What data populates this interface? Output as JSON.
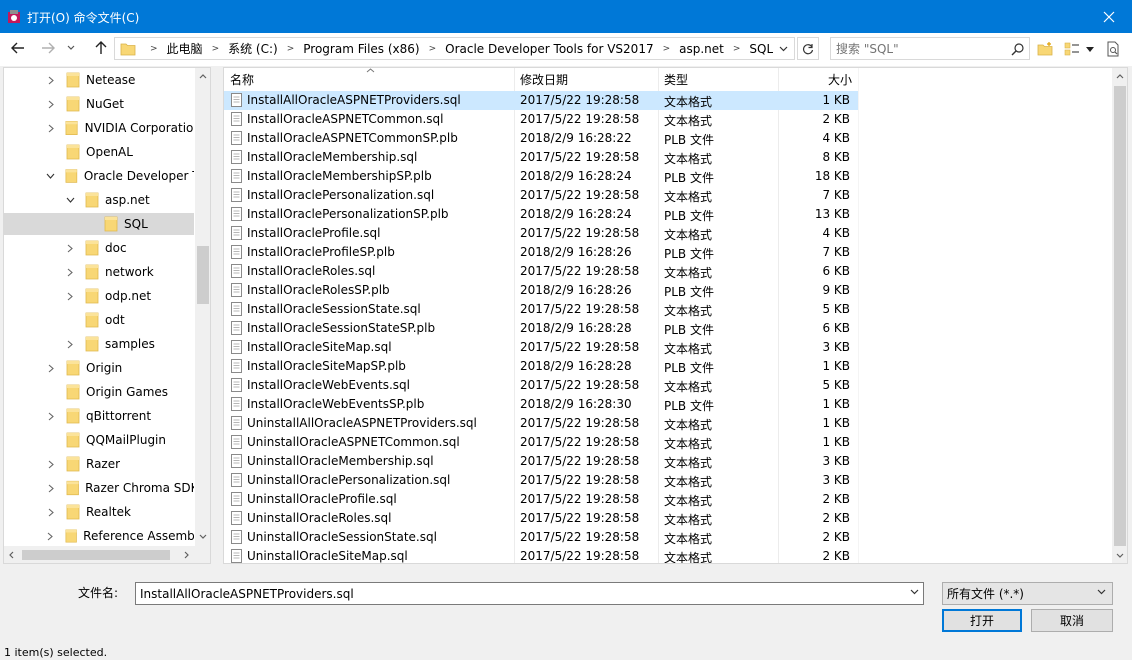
{
  "window": {
    "title": "打开(O) 命令文件(C)"
  },
  "address": {
    "crumbs": [
      "此电脑",
      "系统 (C:)",
      "Program Files (x86)",
      "Oracle Developer Tools for VS2017",
      "asp.net",
      "SQL"
    ]
  },
  "search": {
    "placeholder": "搜索 \"SQL\""
  },
  "tree": {
    "items": [
      {
        "label": "Netease",
        "chevron": "right",
        "indent": 0,
        "selected": false
      },
      {
        "label": "NuGet",
        "chevron": "right",
        "indent": 0,
        "selected": false
      },
      {
        "label": "NVIDIA Corporation",
        "chevron": "right",
        "indent": 0,
        "selected": false
      },
      {
        "label": "OpenAL",
        "chevron": "none",
        "indent": 0,
        "selected": false
      },
      {
        "label": "Oracle Developer To",
        "chevron": "down",
        "indent": 0,
        "selected": false
      },
      {
        "label": "asp.net",
        "chevron": "down",
        "indent": 1,
        "selected": false
      },
      {
        "label": "SQL",
        "chevron": "none",
        "indent": 2,
        "selected": true
      },
      {
        "label": "doc",
        "chevron": "right",
        "indent": 1,
        "selected": false
      },
      {
        "label": "network",
        "chevron": "right",
        "indent": 1,
        "selected": false
      },
      {
        "label": "odp.net",
        "chevron": "right",
        "indent": 1,
        "selected": false
      },
      {
        "label": "odt",
        "chevron": "none",
        "indent": 1,
        "selected": false
      },
      {
        "label": "samples",
        "chevron": "right",
        "indent": 1,
        "selected": false
      },
      {
        "label": "Origin",
        "chevron": "right",
        "indent": 0,
        "selected": false
      },
      {
        "label": "Origin Games",
        "chevron": "none",
        "indent": 0,
        "selected": false
      },
      {
        "label": "qBittorrent",
        "chevron": "right",
        "indent": 0,
        "selected": false
      },
      {
        "label": "QQMailPlugin",
        "chevron": "none",
        "indent": 0,
        "selected": false
      },
      {
        "label": "Razer",
        "chevron": "right",
        "indent": 0,
        "selected": false
      },
      {
        "label": "Razer Chroma SDK",
        "chevron": "right",
        "indent": 0,
        "selected": false
      },
      {
        "label": "Realtek",
        "chevron": "right",
        "indent": 0,
        "selected": false
      },
      {
        "label": "Reference Assemblie",
        "chevron": "right",
        "indent": 0,
        "selected": false
      }
    ]
  },
  "list": {
    "columns": {
      "name": "名称",
      "date": "修改日期",
      "type": "类型",
      "size": "大小"
    },
    "rows": [
      {
        "name": "InstallAllOracleASPNETProviders.sql",
        "date": "2017/5/22 19:28:58",
        "type": "文本格式",
        "size": "1 KB",
        "selected": true
      },
      {
        "name": "InstallOracleASPNETCommon.sql",
        "date": "2017/5/22 19:28:58",
        "type": "文本格式",
        "size": "2 KB"
      },
      {
        "name": "InstallOracleASPNETCommonSP.plb",
        "date": "2018/2/9 16:28:22",
        "type": "PLB 文件",
        "size": "4 KB"
      },
      {
        "name": "InstallOracleMembership.sql",
        "date": "2017/5/22 19:28:58",
        "type": "文本格式",
        "size": "8 KB"
      },
      {
        "name": "InstallOracleMembershipSP.plb",
        "date": "2018/2/9 16:28:24",
        "type": "PLB 文件",
        "size": "18 KB"
      },
      {
        "name": "InstallOraclePersonalization.sql",
        "date": "2017/5/22 19:28:58",
        "type": "文本格式",
        "size": "7 KB"
      },
      {
        "name": "InstallOraclePersonalizationSP.plb",
        "date": "2018/2/9 16:28:24",
        "type": "PLB 文件",
        "size": "13 KB"
      },
      {
        "name": "InstallOracleProfile.sql",
        "date": "2017/5/22 19:28:58",
        "type": "文本格式",
        "size": "4 KB"
      },
      {
        "name": "InstallOracleProfileSP.plb",
        "date": "2018/2/9 16:28:26",
        "type": "PLB 文件",
        "size": "7 KB"
      },
      {
        "name": "InstallOracleRoles.sql",
        "date": "2017/5/22 19:28:58",
        "type": "文本格式",
        "size": "6 KB"
      },
      {
        "name": "InstallOracleRolesSP.plb",
        "date": "2018/2/9 16:28:26",
        "type": "PLB 文件",
        "size": "9 KB"
      },
      {
        "name": "InstallOracleSessionState.sql",
        "date": "2017/5/22 19:28:58",
        "type": "文本格式",
        "size": "5 KB"
      },
      {
        "name": "InstallOracleSessionStateSP.plb",
        "date": "2018/2/9 16:28:28",
        "type": "PLB 文件",
        "size": "6 KB"
      },
      {
        "name": "InstallOracleSiteMap.sql",
        "date": "2017/5/22 19:28:58",
        "type": "文本格式",
        "size": "3 KB"
      },
      {
        "name": "InstallOracleSiteMapSP.plb",
        "date": "2018/2/9 16:28:28",
        "type": "PLB 文件",
        "size": "1 KB"
      },
      {
        "name": "InstallOracleWebEvents.sql",
        "date": "2017/5/22 19:28:58",
        "type": "文本格式",
        "size": "5 KB"
      },
      {
        "name": "InstallOracleWebEventsSP.plb",
        "date": "2018/2/9 16:28:30",
        "type": "PLB 文件",
        "size": "1 KB"
      },
      {
        "name": "UninstallAllOracleASPNETProviders.sql",
        "date": "2017/5/22 19:28:58",
        "type": "文本格式",
        "size": "1 KB"
      },
      {
        "name": "UninstallOracleASPNETCommon.sql",
        "date": "2017/5/22 19:28:58",
        "type": "文本格式",
        "size": "1 KB"
      },
      {
        "name": "UninstallOracleMembership.sql",
        "date": "2017/5/22 19:28:58",
        "type": "文本格式",
        "size": "3 KB"
      },
      {
        "name": "UninstallOraclePersonalization.sql",
        "date": "2017/5/22 19:28:58",
        "type": "文本格式",
        "size": "3 KB"
      },
      {
        "name": "UninstallOracleProfile.sql",
        "date": "2017/5/22 19:28:58",
        "type": "文本格式",
        "size": "2 KB"
      },
      {
        "name": "UninstallOracleRoles.sql",
        "date": "2017/5/22 19:28:58",
        "type": "文本格式",
        "size": "2 KB"
      },
      {
        "name": "UninstallOracleSessionState.sql",
        "date": "2017/5/22 19:28:58",
        "type": "文本格式",
        "size": "2 KB"
      },
      {
        "name": "UninstallOracleSiteMap.sql",
        "date": "2017/5/22 19:28:58",
        "type": "文本格式",
        "size": "2 KB"
      }
    ]
  },
  "bottom": {
    "filename_label": "文件名:",
    "filename_value": "InstallAllOracleASPNETProviders.sql",
    "filetype_value": "所有文件 (*.*)",
    "open_label": "打开",
    "cancel_label": "取消"
  },
  "status": {
    "text": "1 item(s) selected."
  },
  "colors": {
    "titlebar": "#0078d7",
    "selection": "#cce8ff",
    "folder": "#f8d775",
    "tree_selection": "#d9d9d9"
  },
  "icons": {
    "app": "toad-app-icon",
    "close": "close-icon",
    "back": "back-arrow-icon",
    "forward": "forward-arrow-icon",
    "recent": "chevron-down-icon",
    "up": "up-arrow-icon",
    "refresh": "refresh-icon",
    "search": "search-icon"
  }
}
